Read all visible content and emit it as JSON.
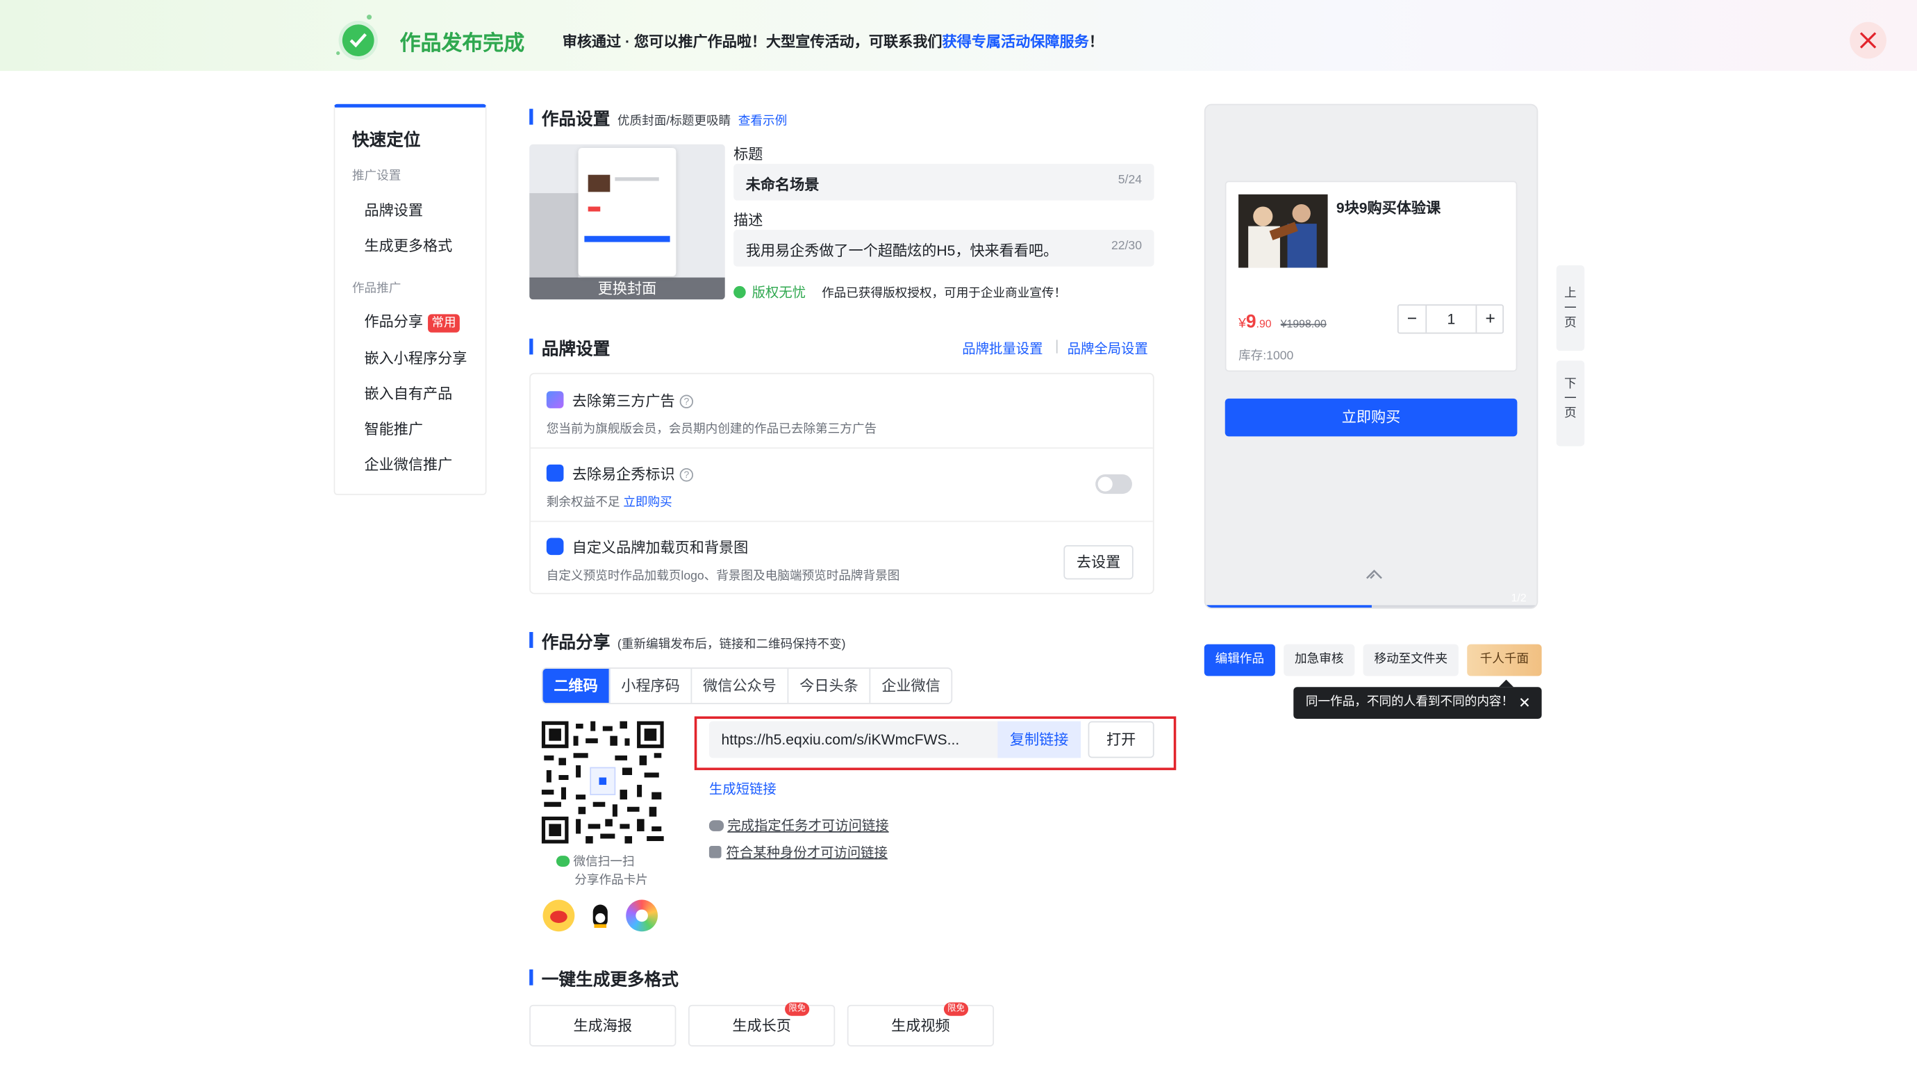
{
  "banner": {
    "title": "作品发布完成",
    "message": "审核通过 · 您可以推广作品啦！大型宣传活动，可联系我们",
    "link": "获得专属活动保障服务",
    "suffix": "！"
  },
  "nav": {
    "title": "快速定位",
    "groups": [
      {
        "label": "推广设置",
        "items": [
          "品牌设置",
          "生成更多格式"
        ]
      },
      {
        "label": "作品推广",
        "items": [
          "作品分享",
          "嵌入小程序分享",
          "嵌入自有产品",
          "智能推广",
          "企业微信推广"
        ]
      }
    ],
    "badge": "常用"
  },
  "work_settings": {
    "heading": "作品设置",
    "sub": "优质封面/标题更吸睛",
    "example_link": "查看示例",
    "cover_button": "更换封面",
    "title_label": "标题",
    "title_value": "未命名场景",
    "title_count": "5/24",
    "desc_label": "描述",
    "desc_value": "我用易企秀做了一个超酷炫的H5，快来看看吧。",
    "desc_count": "22/30",
    "copyright_badge": "版权无忧",
    "copyright_note": "作品已获得版权授权，可用于企业商业宣传！"
  },
  "brand": {
    "heading": "品牌设置",
    "batch_link": "品牌批量设置",
    "global_link": "品牌全局设置",
    "rows": [
      {
        "title": "去除第三方广告",
        "desc": "您当前为旗舰版会员，会员期内创建的作品已去除第三方广告"
      },
      {
        "title": "去除易企秀标识",
        "desc": "剩余权益不足",
        "desc_link": "立即购买"
      },
      {
        "title": "自定义品牌加载页和背景图",
        "desc": "自定义预览时作品加载页logo、背景图及电脑端预览时品牌背景图",
        "button": "去设置"
      }
    ]
  },
  "share": {
    "heading": "作品分享",
    "sub": "(重新编辑发布后，链接和二维码保持不变)",
    "tabs": [
      "二维码",
      "小程序码",
      "微信公众号",
      "今日头条",
      "企业微信"
    ],
    "url": "https://h5.eqxiu.com/s/iKWmcFWS...",
    "copy_button": "复制链接",
    "open_button": "打开",
    "short_link": "生成短链接",
    "task_link": "完成指定任务才可访问链接",
    "identity_link": "符合某种身份才可访问链接",
    "qr_caption_1": "微信扫一扫",
    "qr_caption_2": "分享作品卡片"
  },
  "formats": {
    "heading": "一键生成更多格式",
    "items": [
      {
        "label": "生成海报",
        "tag": ""
      },
      {
        "label": "生成长页",
        "tag": "限免"
      },
      {
        "label": "生成视频",
        "tag": "限免"
      }
    ]
  },
  "preview": {
    "product_title": "9块9购买体验课",
    "price_symbol": "¥",
    "price_main": "9",
    "price_decimal": ".90",
    "price_original": "¥1998.00",
    "quantity": "1",
    "stock": "库存:1000",
    "buy_button": "立即购买",
    "page_indicator": "1/2",
    "progress": 0.5,
    "prev_page": "上一页",
    "next_page": "下一页"
  },
  "actions": {
    "items": [
      "编辑作品",
      "加急审核",
      "移动至文件夹",
      "千人千面"
    ],
    "tooltip": "同一作品，不同的人看到不同的内容！"
  },
  "colors": {
    "accent": "#1a5cff",
    "success": "#2fa84f",
    "danger": "#e2242c",
    "price": "#f04142"
  }
}
